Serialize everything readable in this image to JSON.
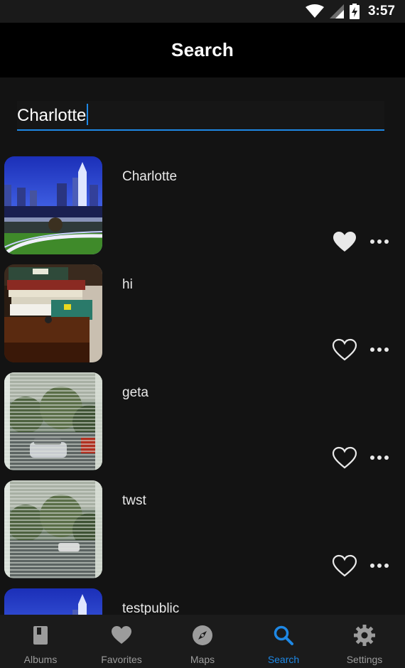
{
  "status_bar": {
    "time": "3:57",
    "icons": [
      "wifi-icon",
      "cellular-signal-icon",
      "battery-charging-icon"
    ]
  },
  "header": {
    "title": "Search"
  },
  "search": {
    "value": "Charlotte"
  },
  "results": [
    {
      "title": "Charlotte",
      "favorited": true,
      "thumbnail": "city-skyline-night"
    },
    {
      "title": "hi",
      "favorited": false,
      "thumbnail": "desk-with-books"
    },
    {
      "title": "geta",
      "favorited": false,
      "thumbnail": "window-blinds-parking-lot"
    },
    {
      "title": "twst",
      "favorited": false,
      "thumbnail": "window-blinds-trees"
    },
    {
      "title": "testpublic",
      "favorited": false,
      "thumbnail": "city-skyline-night"
    }
  ],
  "bottom_nav": {
    "items": [
      {
        "label": "Albums",
        "icon": "album-icon",
        "active": false
      },
      {
        "label": "Favorites",
        "icon": "heart-icon",
        "active": false
      },
      {
        "label": "Maps",
        "icon": "compass-icon",
        "active": false
      },
      {
        "label": "Search",
        "icon": "search-icon",
        "active": true
      },
      {
        "label": "Settings",
        "icon": "gear-icon",
        "active": false
      }
    ]
  },
  "colors": {
    "accent": "#1e88e5",
    "background": "#131313",
    "app_bar": "#000000",
    "nav_bar": "#1b1b1b",
    "inactive_icon": "#9c9c9c"
  }
}
